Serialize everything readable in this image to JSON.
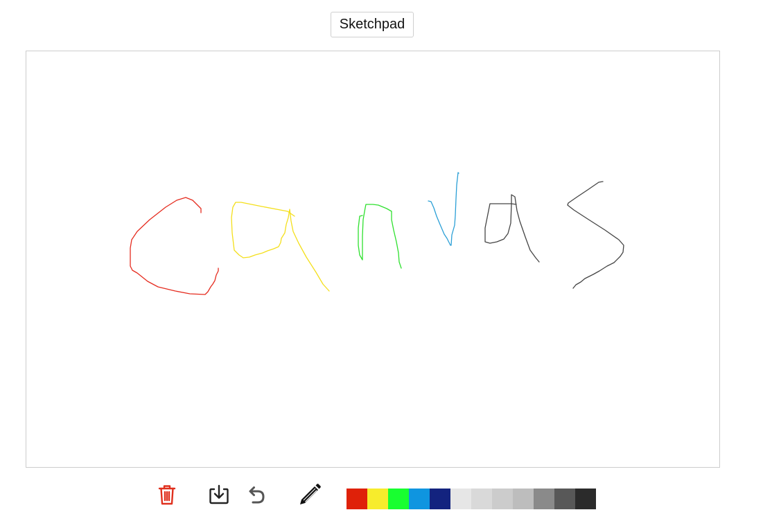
{
  "header": {
    "title_button": "Sketchpad"
  },
  "canvas": {
    "strokes": [
      {
        "color": "#e52b1e",
        "name": "stroke-red-c"
      },
      {
        "color": "#f4df1b",
        "name": "stroke-yellow-a"
      },
      {
        "color": "#2ee02e",
        "name": "stroke-green-n"
      },
      {
        "color": "#2a9fd6",
        "name": "stroke-blue-v"
      },
      {
        "color": "#444444",
        "name": "stroke-black-a"
      },
      {
        "color": "#444444",
        "name": "stroke-black-s"
      }
    ]
  },
  "toolbar": {
    "tools": [
      {
        "name": "clear-button",
        "icon": "trash-icon",
        "color": "#e0301e"
      },
      {
        "name": "download-button",
        "icon": "download-icon",
        "color": "#222222"
      },
      {
        "name": "undo-button",
        "icon": "undo-icon",
        "color": "#555555"
      },
      {
        "name": "pencil-button",
        "icon": "pencil-icon",
        "color": "#111111"
      }
    ],
    "colors": [
      "#df2109",
      "#f7ec2c",
      "#18ff30",
      "#0f95e0",
      "#13237f",
      "#e6e6e6",
      "#d9d9d9",
      "#cccccc",
      "#bdbdbd",
      "#8a8a8a",
      "#585858",
      "#2b2b2b"
    ]
  }
}
